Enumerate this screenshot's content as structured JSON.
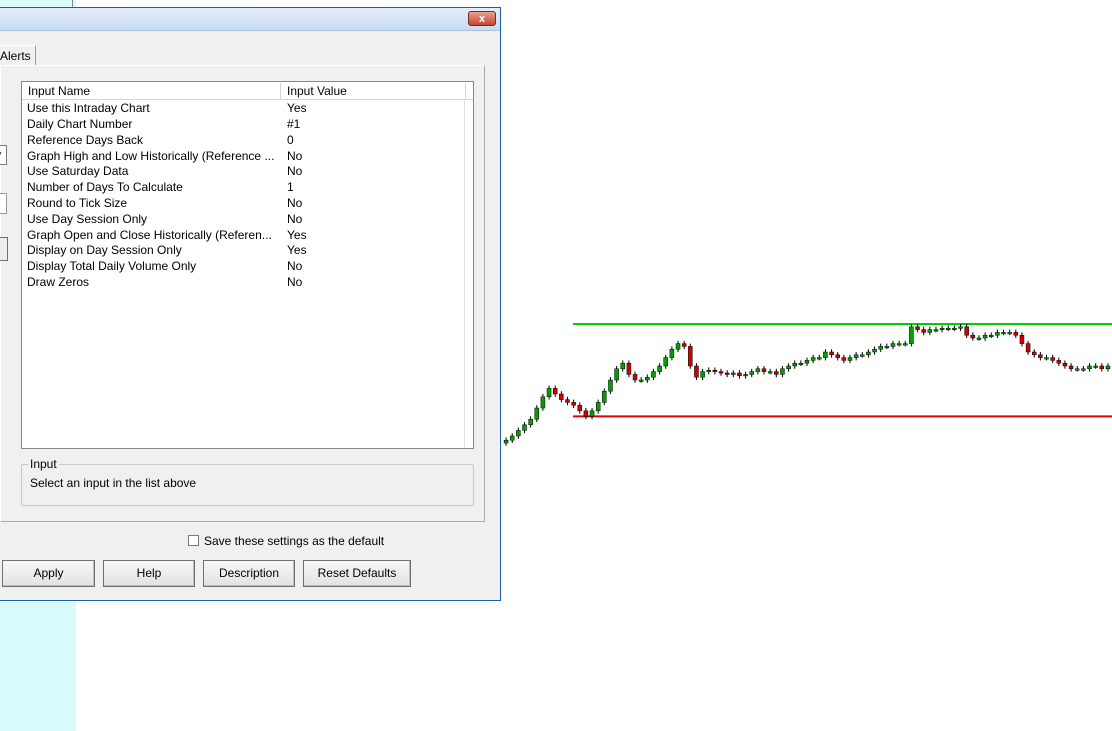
{
  "dialog": {
    "close_label": "x",
    "tab_label": "Alerts",
    "list": {
      "headers": {
        "name": "Input Name",
        "value": "Input Value"
      },
      "rows": [
        {
          "name": "Use this Intraday Chart",
          "value": "Yes"
        },
        {
          "name": "Daily Chart Number",
          "value": "#1"
        },
        {
          "name": "Reference Days Back",
          "value": "0"
        },
        {
          "name": "Graph High and Low Historically (Reference ...",
          "value": "No"
        },
        {
          "name": "Use Saturday Data",
          "value": "No"
        },
        {
          "name": "Number of Days To Calculate",
          "value": "1"
        },
        {
          "name": "Round to Tick Size",
          "value": "No"
        },
        {
          "name": "Use Day Session Only",
          "value": "No"
        },
        {
          "name": "Graph Open and Close Historically (Referen...",
          "value": "Yes"
        },
        {
          "name": "Display on Day Session Only",
          "value": "Yes"
        },
        {
          "name": "Display Total Daily Volume Only",
          "value": "No"
        },
        {
          "name": "Draw Zeros",
          "value": "No"
        }
      ]
    },
    "input_group": {
      "label": "Input",
      "text": "Select an input in the list above"
    },
    "save_default_label": "Save these settings as the default",
    "save_default_checked": false,
    "buttons": {
      "apply": "Apply",
      "help": "Help",
      "description": "Description",
      "reset": "Reset Defaults"
    }
  },
  "colors": {
    "up_candle": "#00a000",
    "down_candle": "#d00000",
    "high_line": "#00d000",
    "low_line": "#e00000",
    "panel_background": "#d9fbfc"
  },
  "chart_data": {
    "type": "candlestick",
    "xlabel": "",
    "ylabel": "",
    "ylim": [
      0,
      100
    ],
    "reference_lines": [
      {
        "name": "high",
        "value": 90
      },
      {
        "name": "low",
        "value": 24
      }
    ],
    "closes": [
      7,
      10,
      14,
      18,
      22,
      30,
      38,
      44,
      40,
      36,
      34,
      32,
      28,
      24,
      28,
      34,
      42,
      50,
      58,
      62,
      54,
      50,
      50,
      52,
      56,
      60,
      66,
      72,
      76,
      74,
      60,
      52,
      56,
      57,
      56,
      55,
      54,
      55,
      53,
      54,
      56,
      58,
      56,
      56,
      54,
      58,
      60,
      62,
      62,
      64,
      66,
      66,
      70,
      68,
      66,
      64,
      66,
      68,
      68,
      70,
      72,
      74,
      74,
      76,
      76,
      76,
      88,
      86,
      84,
      86,
      86,
      87,
      87,
      87,
      88,
      82,
      80,
      80,
      82,
      82,
      84,
      84,
      84,
      82,
      76,
      70,
      68,
      66,
      66,
      64,
      62,
      60,
      58,
      58,
      58,
      60,
      60,
      58,
      60
    ]
  }
}
